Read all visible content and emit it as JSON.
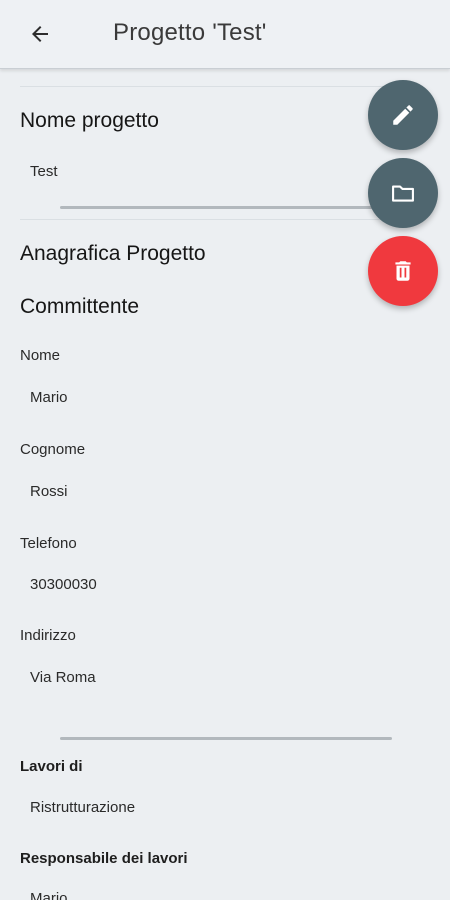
{
  "appbar": {
    "title": "Progetto 'Test'",
    "back_icon": "arrow-left-icon"
  },
  "project_name": {
    "heading": "Nome progetto",
    "value": "Test"
  },
  "anagrafica": {
    "heading": "Anagrafica Progetto"
  },
  "committente": {
    "heading": "Committente",
    "fields": [
      {
        "label": "Nome",
        "value": "Mario"
      },
      {
        "label": "Cognome",
        "value": "Rossi"
      },
      {
        "label": "Telefono",
        "value": "30300030"
      },
      {
        "label": "Indirizzo",
        "value": "Via Roma"
      }
    ]
  },
  "lavori": {
    "label": "Lavori di",
    "value": "Ristrutturazione"
  },
  "responsabile": {
    "label": "Responsabile dei lavori",
    "value": "Mario"
  },
  "fabs": [
    {
      "icon": "pencil-icon",
      "color": "#4f666f"
    },
    {
      "icon": "folder-icon",
      "color": "#4f666f"
    },
    {
      "icon": "trash-icon",
      "color": "#f0393e"
    }
  ],
  "colors": {
    "background": "#eceff2",
    "fab_dark": "#4f666f",
    "fab_danger": "#f0393e"
  }
}
